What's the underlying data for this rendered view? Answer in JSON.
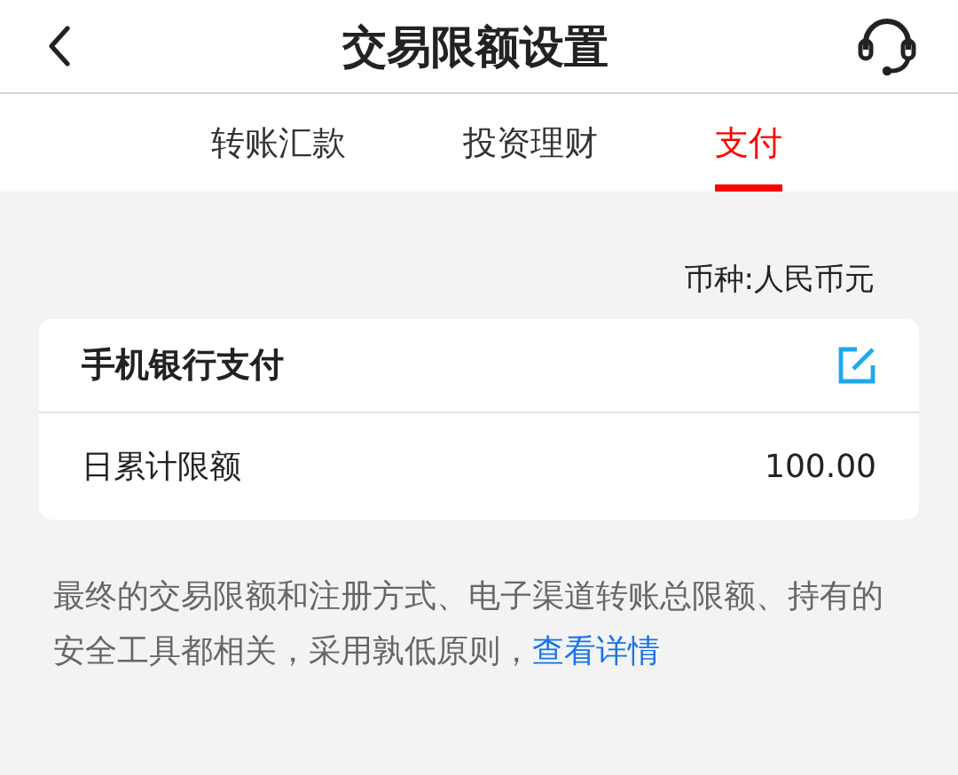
{
  "header": {
    "title": "交易限额设置"
  },
  "tabs": [
    {
      "label": "转账汇款",
      "selected": false
    },
    {
      "label": "投资理财",
      "selected": false
    },
    {
      "label": "支付",
      "selected": true
    }
  ],
  "currency": "币种:人民币元",
  "card": {
    "title": "手机银行支付",
    "rows": [
      {
        "label": "日累计限额",
        "value": "100.00"
      }
    ]
  },
  "note": {
    "text": "最终的交易限额和注册方式、电子渠道转账总限额、持有的安全工具都相关，采用孰低原则，",
    "link": "查看详情"
  }
}
